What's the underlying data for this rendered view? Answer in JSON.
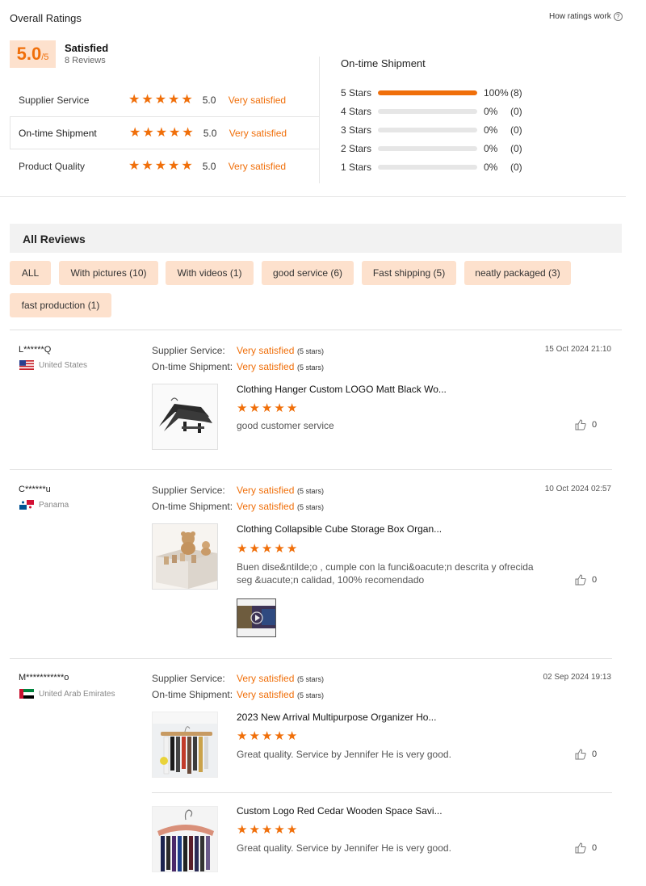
{
  "header": {
    "title": "Overall Ratings",
    "how_link": "How ratings work",
    "help_icon": "?"
  },
  "overall": {
    "score": "5.0",
    "out_of": "/5",
    "status": "Satisfied",
    "reviews_count": "8 Reviews"
  },
  "categories": [
    {
      "label": "Supplier Service",
      "score": "5.0",
      "status": "Very satisfied",
      "stars": 5
    },
    {
      "label": "On-time Shipment",
      "score": "5.0",
      "status": "Very satisfied",
      "stars": 5,
      "selected": true
    },
    {
      "label": "Product Quality",
      "score": "5.0",
      "status": "Very satisfied",
      "stars": 5
    }
  ],
  "distribution": {
    "title": "On-time Shipment",
    "rows": [
      {
        "label": "5 Stars",
        "percent": "100%",
        "count": "(8)",
        "fraction": 1.0
      },
      {
        "label": "4 Stars",
        "percent": "0%",
        "count": "(0)",
        "fraction": 0
      },
      {
        "label": "3 Stars",
        "percent": "0%",
        "count": "(0)",
        "fraction": 0
      },
      {
        "label": "2 Stars",
        "percent": "0%",
        "count": "(0)",
        "fraction": 0
      },
      {
        "label": "1 Stars",
        "percent": "0%",
        "count": "(0)",
        "fraction": 0
      }
    ]
  },
  "all_reviews": {
    "title": "All Reviews",
    "filters": [
      "ALL",
      "With pictures (10)",
      "With videos (1)",
      "good service (6)",
      "Fast shipping (5)",
      "neatly packaged (3)",
      "fast production (1)"
    ]
  },
  "reviews": [
    {
      "user": "L******Q",
      "country": "United States",
      "date": "15 Oct 2024 21:10",
      "meta": [
        {
          "key": "Supplier Service:",
          "value": "Very satisfied",
          "stars": "(5 stars)"
        },
        {
          "key": "On-time Shipment:",
          "value": "Very satisfied",
          "stars": "(5 stars)"
        }
      ],
      "products": [
        {
          "title": "Clothing Hanger Custom LOGO Matt Black Wo...",
          "comment": "good customer service",
          "likes": "0"
        }
      ]
    },
    {
      "user": "C******u",
      "country": "Panama",
      "date": "10 Oct 2024 02:57",
      "meta": [
        {
          "key": "Supplier Service:",
          "value": "Very satisfied",
          "stars": "(5 stars)"
        },
        {
          "key": "On-time Shipment:",
          "value": "Very satisfied",
          "stars": "(5 stars)"
        }
      ],
      "products": [
        {
          "title": "Clothing Collapsible Cube Storage Box Organ...",
          "comment": "Buen dise&ntilde;o , cumple con la funci&oacute;n descrita y ofrecida seg &uacute;n calidad, 100% recomendado",
          "likes": "0"
        }
      ]
    },
    {
      "user": "M***********o",
      "country": "United Arab Emirates",
      "date": "02 Sep 2024 19:13",
      "meta": [
        {
          "key": "Supplier Service:",
          "value": "Very satisfied",
          "stars": "(5 stars)"
        },
        {
          "key": "On-time Shipment:",
          "value": "Very satisfied",
          "stars": "(5 stars)"
        }
      ],
      "products": [
        {
          "title": "2023 New Arrival Multipurpose Organizer Ho...",
          "comment": "Great quality. Service by Jennifer He is very good.",
          "likes": "0"
        },
        {
          "title": "Custom Logo Red Cedar Wooden Space Savi...",
          "comment": "Great quality. Service by Jennifer He is very good.",
          "likes": "0"
        }
      ]
    }
  ],
  "colors": {
    "accent": "#f06f0a",
    "chip_bg": "#fde1cd",
    "score_bg": "#fde1cd"
  },
  "icons": [
    "help-icon",
    "star-icon",
    "thumbs-up-icon",
    "flag-icon",
    "play-icon"
  ]
}
